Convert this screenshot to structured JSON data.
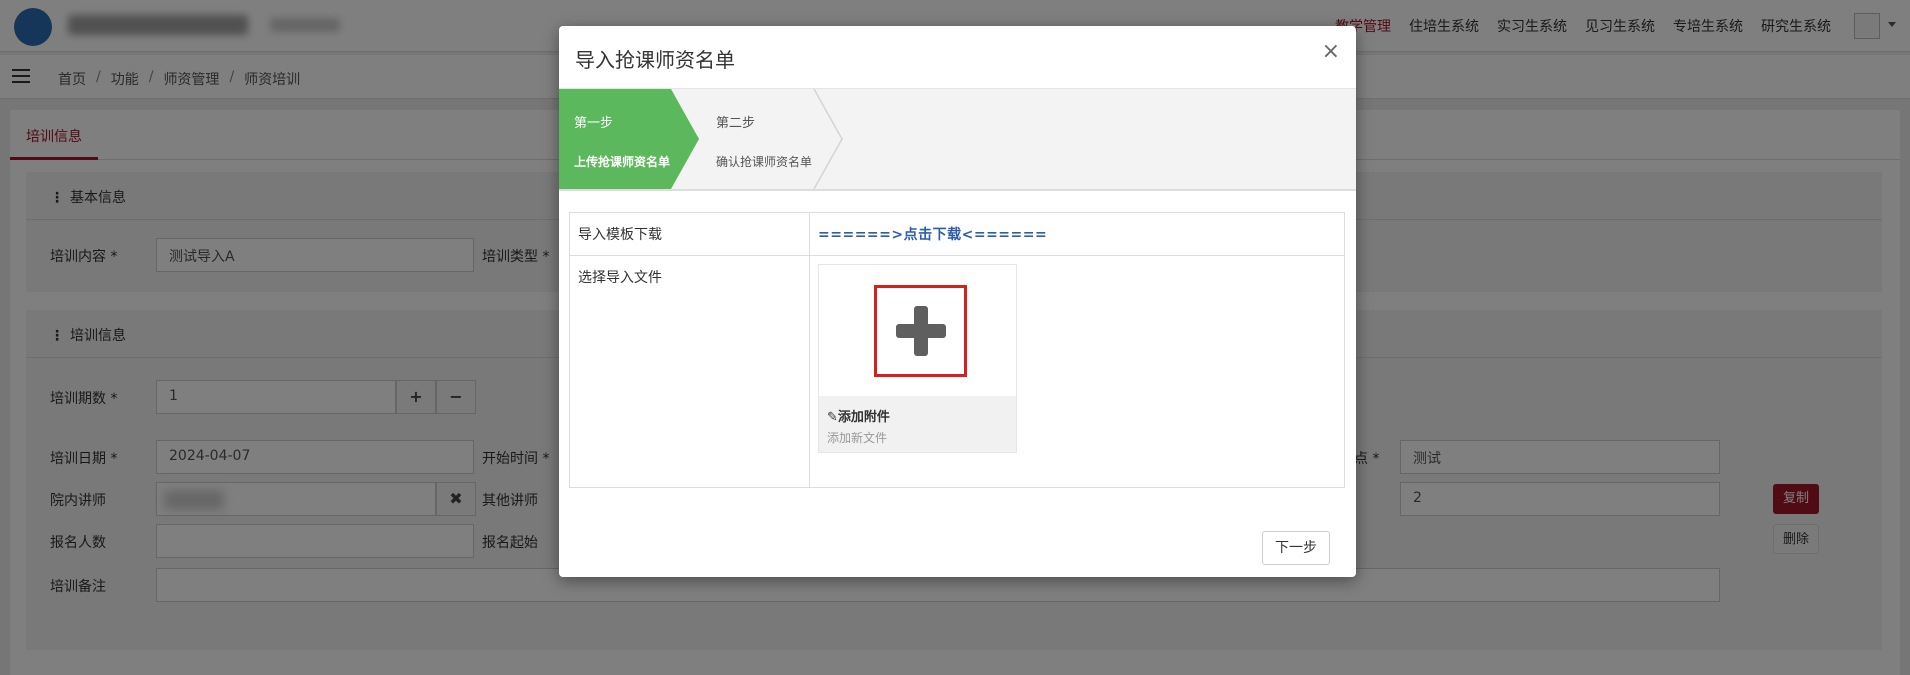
{
  "topnav": {
    "items": [
      "教学管理",
      "住培生系统",
      "实习生系统",
      "见习生系统",
      "专培生系统",
      "研究生系统"
    ],
    "active_index": 0
  },
  "breadcrumb": [
    "首页",
    "功能",
    "师资管理",
    "师资培训"
  ],
  "tabs": [
    {
      "label": "培训信息"
    }
  ],
  "basic_panel": {
    "title": "基本信息",
    "content_label": "培训内容 *",
    "content_value": "测试导入A",
    "type_label": "培训类型 *"
  },
  "train_panel": {
    "title": "培训信息",
    "periods_label": "培训期数 *",
    "periods_value": "1",
    "date_label": "培训日期 *",
    "date_value": "2024-04-07",
    "start_time_label": "开始时间 *",
    "location_label_suffix": "点 *",
    "location_value": "测试",
    "inner_lecturer_label": "院内讲师",
    "other_lecturer_label": "其他讲师",
    "other_value": "2",
    "signup_count_label": "报名人数",
    "signup_start_label": "报名起始",
    "remark_label": "培训备注",
    "copy_label": "复制",
    "delete_label": "删除"
  },
  "modal": {
    "title": "导入抢课师资名单",
    "close_symbol": "×",
    "steps": [
      {
        "name": "第一步",
        "desc": "上传抢课师资名单",
        "active": true
      },
      {
        "name": "第二步",
        "desc": "确认抢课师资名单",
        "active": false
      }
    ],
    "rows": [
      {
        "label": "导入模板下载",
        "link_text": "======>点击下载<======"
      },
      {
        "label": "选择导入文件"
      }
    ],
    "upload": {
      "title": "✎添加附件",
      "subtitle": "添加新文件"
    },
    "next_label": "下一步"
  },
  "colors": {
    "brand": "#a3162b",
    "step_active": "#5cb85c",
    "link": "#2d5ea8",
    "highlight": "#d81e1e"
  }
}
